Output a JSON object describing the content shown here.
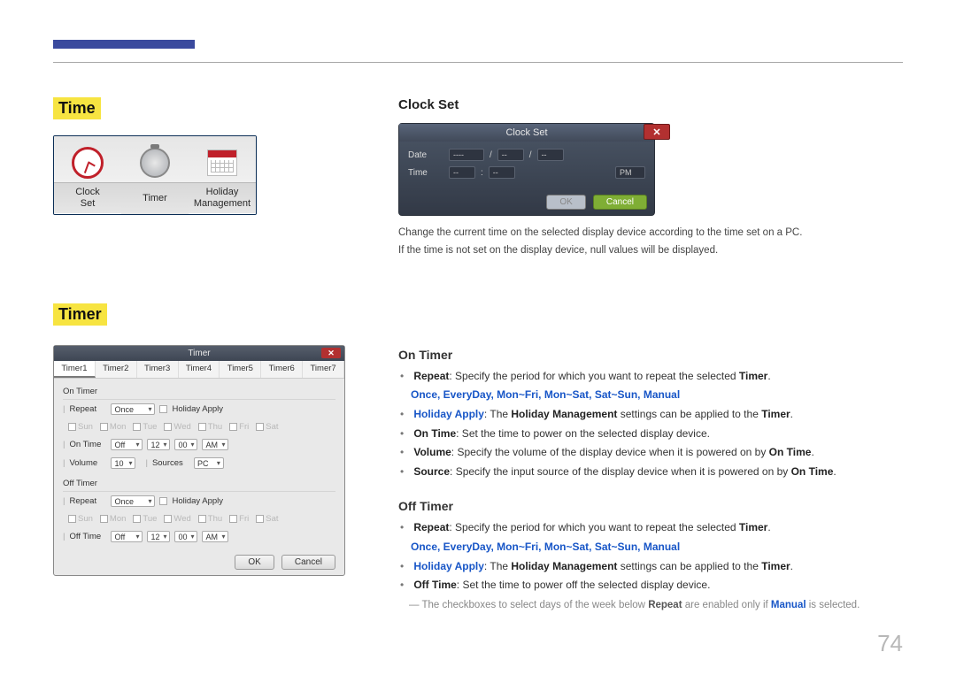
{
  "page_number": "74",
  "left": {
    "heading_time": "Time",
    "heading_timer": "Timer",
    "time_items": [
      {
        "label": "Clock\nSet"
      },
      {
        "label": "Timer"
      },
      {
        "label": "Holiday\nManagement"
      }
    ]
  },
  "clock_set_dialog": {
    "title": "Clock Set",
    "close": "✕",
    "date_label": "Date",
    "time_label": "Time",
    "date_v1": "----",
    "date_v2": "--",
    "date_v3": "--",
    "time_v1": "--",
    "time_v2": "--",
    "time_ampm": "PM",
    "slash": "/",
    "colon": ":",
    "ok": "OK",
    "cancel": "Cancel"
  },
  "timer_dialog": {
    "title": "Timer",
    "close": "✕",
    "tabs": [
      "Timer1",
      "Timer2",
      "Timer3",
      "Timer4",
      "Timer5",
      "Timer6",
      "Timer7"
    ],
    "on_timer_h": "On Timer",
    "off_timer_h": "Off Timer",
    "repeat_lab": "Repeat",
    "repeat_val": "Once",
    "holiday_apply": "Holiday Apply",
    "days": [
      "Sun",
      "Mon",
      "Tue",
      "Wed",
      "Thu",
      "Fri",
      "Sat"
    ],
    "on_time_lab": "On Time",
    "off_time_lab": "Off Time",
    "onoff_val": "Off",
    "hh": "12",
    "mm": "00",
    "ampm": "AM",
    "volume_lab": "Volume",
    "volume_val": "10",
    "sources_lab": "Sources",
    "sources_val": "PC",
    "ok": "OK",
    "cancel": "Cancel"
  },
  "right": {
    "clock_set_h": "Clock Set",
    "clock_desc1": "Change the current time on the selected display device according to the time set on a PC.",
    "clock_desc2": "If the time is not set on the display device, null values will be displayed.",
    "on_timer_h": "On Timer",
    "off_timer_h": "Off Timer",
    "repeat_pre": "Repeat",
    "repeat_txt": ": Specify the period for which you want to repeat the selected ",
    "timer_word": "Timer",
    "repeat_opts": "Once, EveryDay, Mon~Fri, Mon~Sat, Sat~Sun, Manual",
    "holiday_pre": "Holiday Apply",
    "holiday_mid": ": The ",
    "holiday_mgmt": "Holiday Management",
    "holiday_end": " settings can be applied to the ",
    "on_time_bold": "On Time",
    "on_time_txt": ": Set the time to power on the selected display device.",
    "volume_bold": "Volume",
    "volume_txt": ": Specify the volume of the display device when it is powered on by ",
    "source_bold": "Source",
    "source_txt": ": Specify the input source of the display device when it is powered on by ",
    "off_time_bold": "Off Time",
    "off_time_txt": ": Set the time to power off the selected display device.",
    "note_pre": "― The checkboxes to select days of the week below ",
    "note_mid": " are enabled only if ",
    "note_manual": "Manual",
    "note_end": " is selected.",
    "period": "."
  }
}
